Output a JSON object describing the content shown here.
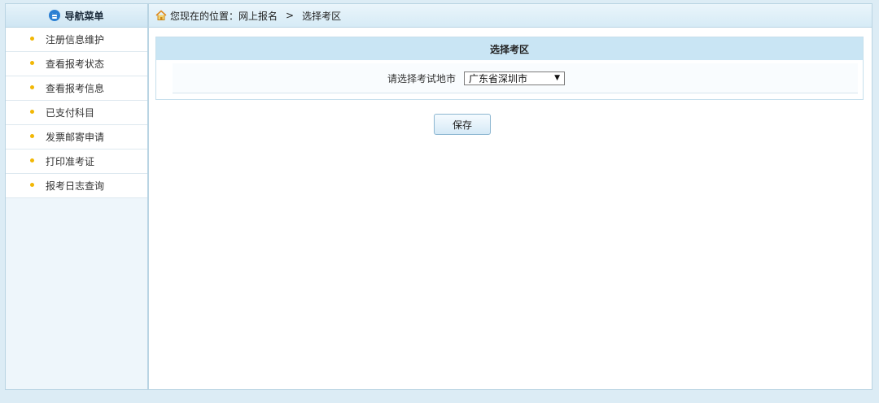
{
  "sidebar": {
    "header_title": "导航菜单",
    "items": [
      {
        "label": "注册信息维护"
      },
      {
        "label": "查看报考状态"
      },
      {
        "label": "查看报考信息"
      },
      {
        "label": "已支付科目"
      },
      {
        "label": "发票邮寄申请"
      },
      {
        "label": "打印准考证"
      },
      {
        "label": "报考日志查询"
      }
    ]
  },
  "breadcrumb": {
    "prefix": "您现在的位置：网上报名",
    "separator": ">",
    "current": "选择考区"
  },
  "form": {
    "title": "选择考区",
    "city_label": "请选择考试地市",
    "city_selected": "广东省深圳市"
  },
  "actions": {
    "save_label": "保存"
  },
  "colors": {
    "accent": "#2b7fd3",
    "bullet": "#f2b705",
    "header_bg": "#c9e5f4"
  }
}
